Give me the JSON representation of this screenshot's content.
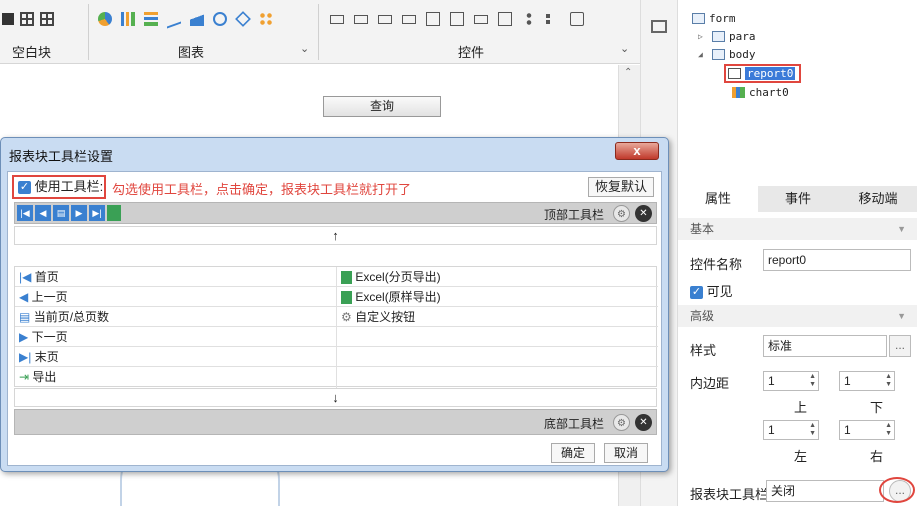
{
  "ribbon": {
    "section1_label": "空白块",
    "section2_label": "图表",
    "section3_label": "控件"
  },
  "canvas": {
    "query_button": "查询"
  },
  "tree": {
    "form": "form",
    "para": "para",
    "body": "body",
    "report": "report0",
    "chart": "chart0"
  },
  "panel": {
    "tabs": [
      "属性",
      "事件",
      "移动端"
    ],
    "group_basic": "基本",
    "name_label": "控件名称",
    "name_value": "report0",
    "visible_label": "可见",
    "group_advanced": "高级",
    "style_label": "样式",
    "style_value": "标准",
    "padding_label": "内边距",
    "pad_top": "1",
    "pad_bottom": "1",
    "pad_left": "1",
    "pad_right": "1",
    "lbl_top": "上",
    "lbl_bottom": "下",
    "lbl_left": "左",
    "lbl_right": "右",
    "toolbar_label": "报表块工具栏",
    "toolbar_value": "关闭",
    "ellipsis": "..."
  },
  "dialog": {
    "title": "报表块工具栏设置",
    "close": "x",
    "use_toolbar": "使用工具栏:",
    "hint": "勾选使用工具栏，点击确定，报表块工具栏就打开了",
    "reset": "恢复默认",
    "top_toolbar": "顶部工具栏",
    "bottom_toolbar": "底部工具栏",
    "up_arrow": "↑",
    "down_arrow": "↓",
    "left_items": [
      "首页",
      "上一页",
      "当前页/总页数",
      "下一页",
      "末页",
      "导出"
    ],
    "right_items": [
      "Excel(分页导出)",
      "Excel(原样导出)",
      "自定义按钮"
    ],
    "confirm": "确定",
    "cancel": "取消"
  },
  "colors": {
    "accent_red": "#e0463e",
    "selection_blue": "#3b7ad8",
    "dialog_bg": "#c9dcf2"
  }
}
